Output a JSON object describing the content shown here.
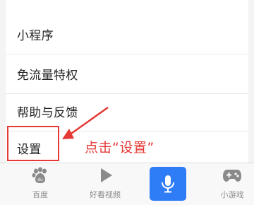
{
  "menu": {
    "items": [
      {
        "label": "小程序"
      },
      {
        "label": "免流量特权"
      },
      {
        "label": "帮助与反馈"
      },
      {
        "label": "设置"
      }
    ]
  },
  "annotation": {
    "text": "点击“设置”",
    "color": "#e53935"
  },
  "bottom_nav": {
    "items": [
      {
        "label": "百度",
        "icon": "baidu-paw-icon"
      },
      {
        "label": "好看视频",
        "icon": "play-icon"
      },
      {
        "label": "",
        "icon": "microphone-icon"
      },
      {
        "label": "小游戏",
        "icon": "gamepad-icon"
      }
    ],
    "active_color": "#2e7df6"
  }
}
